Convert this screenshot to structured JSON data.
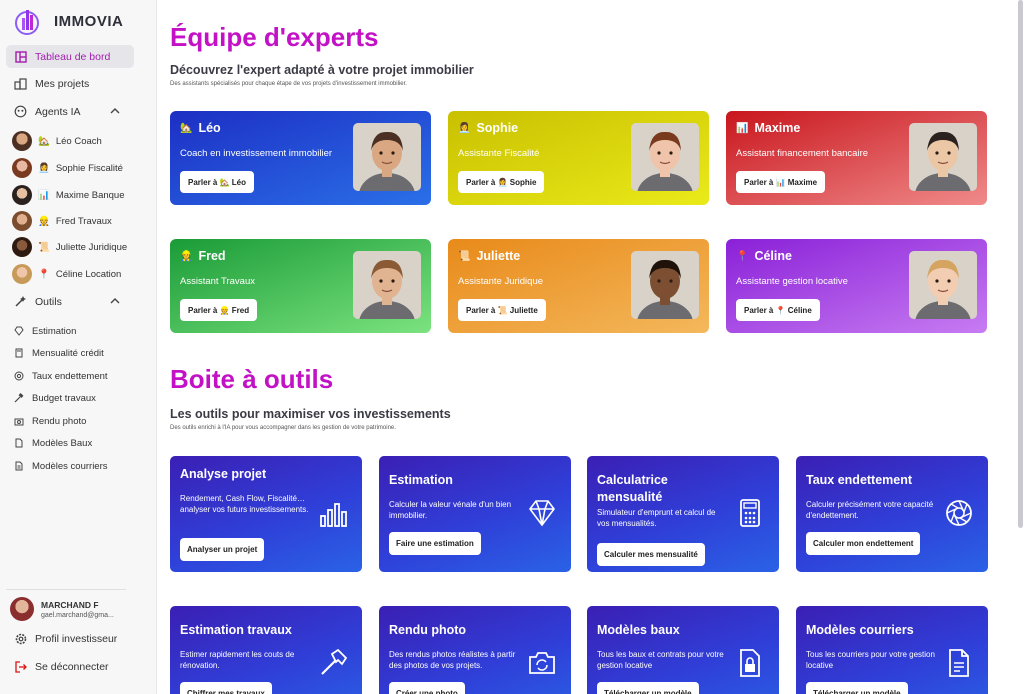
{
  "brand": {
    "name": "IMMOVIA"
  },
  "sidebar": {
    "dashboard": "Tableau de bord",
    "projects": "Mes projets",
    "agents_header": "Agents IA",
    "agents": [
      {
        "label": "Léo Coach",
        "emoji": "🏡"
      },
      {
        "label": "Sophie Fiscalité",
        "emoji": "👩‍💼"
      },
      {
        "label": "Maxime Banque",
        "emoji": "📊"
      },
      {
        "label": "Fred Travaux",
        "emoji": "👷"
      },
      {
        "label": "Juliette Juridique",
        "emoji": "📜"
      },
      {
        "label": "Céline Location",
        "emoji": "📍"
      }
    ],
    "tools_header": "Outils",
    "tools": [
      "Estimation",
      "Mensualité crédit",
      "Taux endettement",
      "Budget travaux",
      "Rendu photo",
      "Modèles Baux",
      "Modèles courriers"
    ],
    "user": {
      "name": "MARCHAND F",
      "email": "gael.marchand@gma..."
    },
    "profile": "Profil investisseur",
    "logout": "Se déconnecter"
  },
  "experts": {
    "title": "Équipe d'experts",
    "heading": "Découvrez l'expert adapté à votre projet immobilier",
    "subheading": "Des assistants spécialisés pour chaque étape de vos projets d'investissement immobilier.",
    "cards": [
      {
        "emoji": "🏡",
        "name": "Léo",
        "role": "Coach en investissement immobilier",
        "button": "Parler à 🏡 Léo",
        "color_from": "#1d2fc4",
        "color_to": "#2a6fe8"
      },
      {
        "emoji": "👩‍💼",
        "name": "Sophie",
        "role": "Assistante Fiscalité",
        "button": "Parler à 👩‍💼 Sophie",
        "color_from": "#c9c000",
        "color_to": "#eaea1a"
      },
      {
        "emoji": "📊",
        "name": "Maxime",
        "role": "Assistant financement bancaire",
        "button": "Parler à 📊 Maxime",
        "color_from": "#c8161d",
        "color_to": "#f08a8a"
      },
      {
        "emoji": "👷",
        "name": "Fred",
        "role": "Assistant Travaux",
        "button": "Parler à 👷 Fred",
        "color_from": "#1a9b37",
        "color_to": "#7be37f"
      },
      {
        "emoji": "📜",
        "name": "Juliette",
        "role": "Assistante Juridique",
        "button": "Parler à 📜 Juliette",
        "color_from": "#e88a1a",
        "color_to": "#f4b85c"
      },
      {
        "emoji": "📍",
        "name": "Céline",
        "role": "Assistante gestion locative",
        "button": "Parler à 📍 Céline",
        "color_from": "#8a20d8",
        "color_to": "#c77cf2"
      }
    ]
  },
  "toolbox": {
    "title": "Boite à outils",
    "heading": "Les outils pour maximiser vos investissements",
    "subheading": "Des outils enrichi à l'IA pour vous accompagner dans les gestion de votre patrimoine.",
    "cards": [
      {
        "title": "Analyse projet",
        "desc": "Rendement, Cash Flow, Fiscalité… analyser vos futurs investissements.",
        "button": "Analyser un projet",
        "icon": "bar-chart-icon"
      },
      {
        "title": "Estimation",
        "desc": "Calculer la valeur vénale d'un bien immobilier.",
        "button": "Faire une estimation",
        "icon": "diamond-icon"
      },
      {
        "title": "Calculatrice mensualité",
        "desc": "Simulateur d'emprunt et calcul de vos mensualités.",
        "button": "Calculer mes mensualité",
        "icon": "calculator-icon"
      },
      {
        "title": "Taux endettement",
        "desc": "Calculer précisément votre capacité d'endettement.",
        "button": "Calculer mon endettement",
        "icon": "aperture-icon"
      },
      {
        "title": "Estimation travaux",
        "desc": "Estimer rapidement les couts de rénovation.",
        "button": "Chiffrer mes travaux",
        "icon": "hammer-icon"
      },
      {
        "title": "Rendu photo",
        "desc": "Des rendus photos réalistes à partir des photos de vos projets.",
        "button": "Créer une photo",
        "icon": "camera-refresh-icon"
      },
      {
        "title": "Modèles baux",
        "desc": "Tous les baux et contrats pour votre gestion locative",
        "button": "Télécharger un modèle",
        "icon": "lock-file-icon"
      },
      {
        "title": "Modèles courriers",
        "desc": "Tous les courriers pour votre gestion locative",
        "button": "Télécharger un modèle",
        "icon": "document-icon"
      }
    ]
  }
}
